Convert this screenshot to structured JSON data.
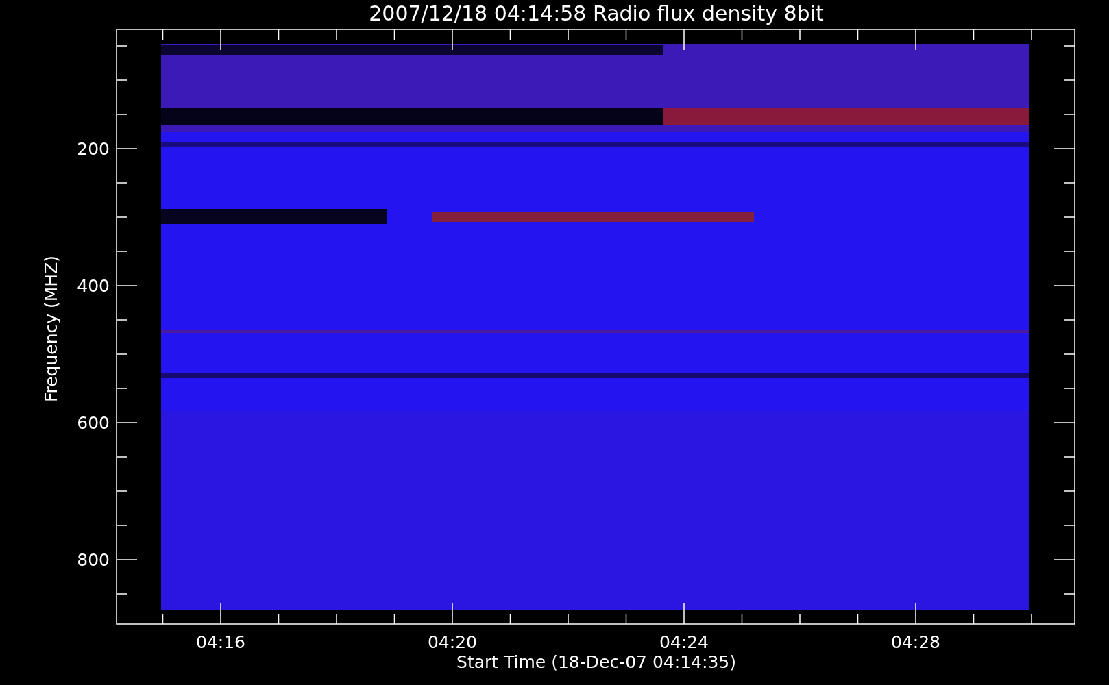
{
  "plot": {
    "title": "2007/12/18 04:14:58 Radio flux density 8bit",
    "ylabel": "Frequency (MHZ)",
    "xlabel": "Start Time (18-Dec-07 04:14:35)",
    "y_tick_labels": [
      "200",
      "400",
      "600",
      "800"
    ],
    "x_tick_labels": [
      "04:16",
      "04:20",
      "04:24",
      "04:28"
    ]
  }
}
